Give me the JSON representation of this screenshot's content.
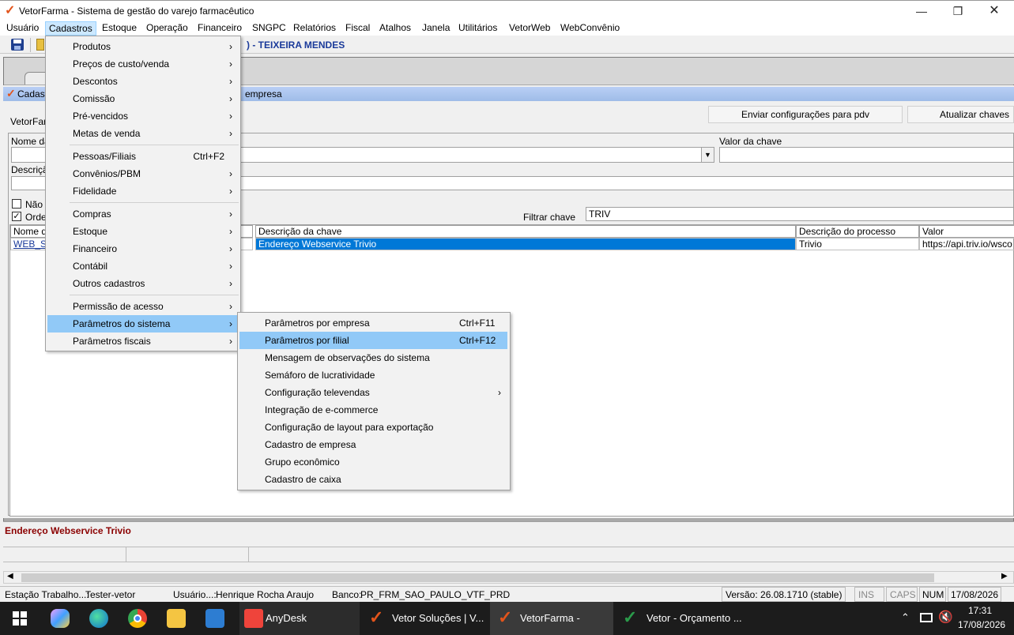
{
  "window": {
    "title": "VetorFarma - Sistema de gestão do varejo farmacêutico",
    "logo_glyph": "✓"
  },
  "menubar": [
    "Usuário",
    "Cadastros",
    "Estoque",
    "Operação",
    "Financeiro",
    "SNGPC",
    "Relatórios",
    "Fiscal",
    "Atalhos",
    "Janela",
    "Utilitários",
    "VetorWeb",
    "WebConvênio"
  ],
  "header": {
    "company": ") - TEIXEIRA MENDES"
  },
  "inner_window": {
    "caption_left": "Cadast",
    "caption_right": "empresa",
    "label_vetorfarma": "VetorFarma",
    "btn_enviar": "Enviar configurações para  pdv",
    "btn_atualizar": "Atualizar chaves",
    "label_nome": "Nome da",
    "label_valor": "Valor da chave",
    "label_descricao": "Descriçã",
    "chk_nao": "Não",
    "chk_ordem": "Orde",
    "label_filtrar": "Filtrar chave",
    "filtrar_value": "TRIV",
    "grid": {
      "headers": [
        "Nome da",
        "Descrição  da chave",
        "Descrição do processo",
        "Valor"
      ],
      "rows": [
        [
          "WEB_S",
          "Endereço Webservice Trivio",
          "Trivio",
          "https://api.triv.io/wsco"
        ]
      ]
    },
    "footer_text": "Endereço Webservice Trivio"
  },
  "cadastros_menu": {
    "groups": [
      [
        {
          "label": "Produtos",
          "arrow": true
        },
        {
          "label": "Preços de custo/venda",
          "arrow": true
        },
        {
          "label": "Descontos",
          "arrow": true
        },
        {
          "label": "Comissão",
          "arrow": true
        },
        {
          "label": "Pré-vencidos",
          "arrow": true
        },
        {
          "label": "Metas de venda",
          "arrow": true
        }
      ],
      [
        {
          "label": "Pessoas/Filiais",
          "shortcut": "Ctrl+F2"
        },
        {
          "label": "Convênios/PBM",
          "arrow": true
        },
        {
          "label": "Fidelidade",
          "arrow": true
        }
      ],
      [
        {
          "label": "Compras",
          "arrow": true
        },
        {
          "label": "Estoque",
          "arrow": true
        },
        {
          "label": "Financeiro",
          "arrow": true
        },
        {
          "label": "Contábil",
          "arrow": true
        },
        {
          "label": "Outros cadastros",
          "arrow": true
        }
      ],
      [
        {
          "label": "Permissão de acesso",
          "arrow": true
        },
        {
          "label": "Parâmetros do sistema",
          "arrow": true,
          "highlight": true
        },
        {
          "label": "Parâmetros fiscais",
          "arrow": true
        }
      ]
    ]
  },
  "submenu": [
    {
      "label": "Parâmetros por empresa",
      "shortcut": "Ctrl+F11"
    },
    {
      "label": "Parâmetros por filial",
      "shortcut": "Ctrl+F12",
      "highlight": true
    },
    {
      "label": "Mensagem de observações do sistema"
    },
    {
      "label": "Semáforo de lucratividade"
    },
    {
      "label": "Configuração televendas",
      "arrow": true
    },
    {
      "label": "Integração de e-commerce"
    },
    {
      "label": "Configuração de layout para exportação"
    },
    {
      "label": "Cadastro de empresa"
    },
    {
      "label": "Grupo econômico"
    },
    {
      "label": "Cadastro de caixa"
    }
  ],
  "status": {
    "estacao_label": "Estação Trabalho...:",
    "estacao_value": "Tester-vetor",
    "usuario_label": "Usuário...:",
    "usuario_value": "Henrique Rocha Araujo",
    "banco_label": "Banco:",
    "banco_value": "PR_FRM_SAO_PAULO_VTF_PRD",
    "versao": "Versão: 26.08.1710 (stable)",
    "ins": "INS",
    "caps": "CAPS",
    "num": "NUM",
    "date": "17/08/2026"
  },
  "taskbar": {
    "apps": [
      "AnyDesk",
      "Vetor Soluções | V...",
      "VetorFarma - Siste...",
      "Vetor - Orçamento ..."
    ],
    "time": "17:31",
    "date": "17/08/2026"
  }
}
